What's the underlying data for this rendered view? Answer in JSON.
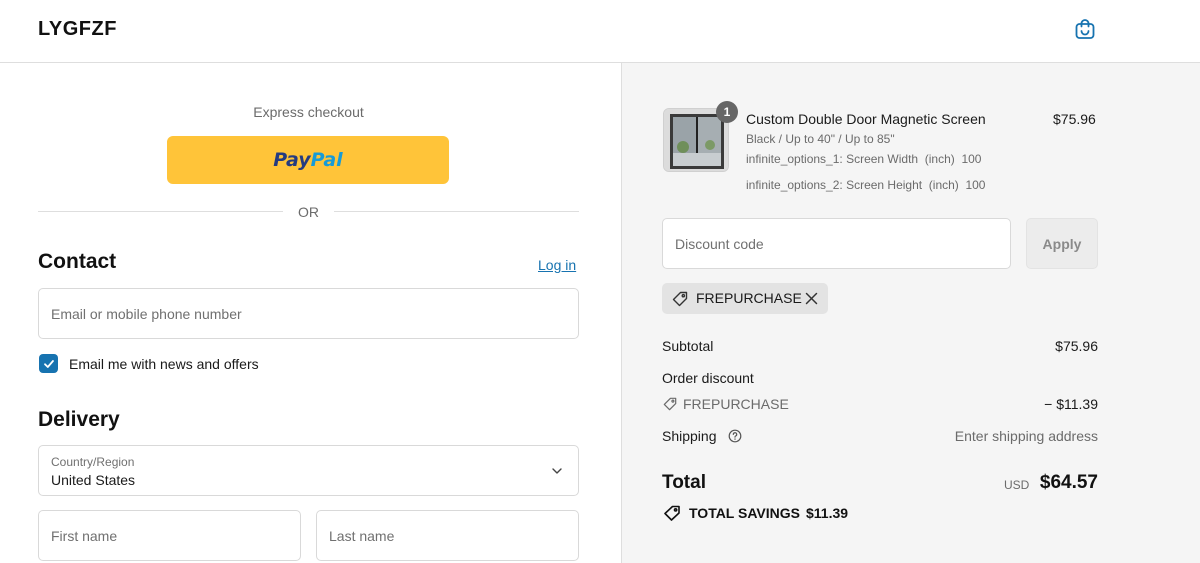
{
  "header": {
    "brand": "LYGFZF",
    "cart_icon": "shopping-bag-icon"
  },
  "express": {
    "title": "Express checkout",
    "paypal_part1": "Pay",
    "paypal_part2": "Pal",
    "divider": "OR"
  },
  "contact": {
    "title": "Contact",
    "login_link": "Log in",
    "email_placeholder": "Email or mobile phone number",
    "newsletter_label": "Email me with news and offers",
    "newsletter_checked": true
  },
  "delivery": {
    "title": "Delivery",
    "country_label": "Country/Region",
    "country_value": "United States",
    "first_name_placeholder": "First name",
    "last_name_placeholder": "Last name"
  },
  "order": {
    "item": {
      "quantity": "1",
      "name": "Custom Double Door Magnetic Screen",
      "variant": "Black / Up to 40\" / Up to 85\"",
      "option1": "infinite_options_1: Screen Width  (inch)  100",
      "option2": "infinite_options_2: Screen Height  (inch)  100",
      "price": "$75.96"
    },
    "discount_placeholder": "Discount code",
    "apply_label": "Apply",
    "applied_code": "FREPURCHASE",
    "subtotal_label": "Subtotal",
    "subtotal_value": "$75.96",
    "order_discount_label": "Order discount",
    "discount_code_label": "FREPURCHASE",
    "discount_value": "− $11.39",
    "shipping_label": "Shipping",
    "shipping_value": "Enter shipping address",
    "total_label": "Total",
    "currency": "USD",
    "total_value": "$64.57",
    "savings_label": "TOTAL SAVINGS",
    "savings_value": "$11.39"
  },
  "colors": {
    "paypal_yellow": "#ffc439",
    "link_blue": "#1773b0",
    "summary_bg": "#f5f5f5"
  }
}
